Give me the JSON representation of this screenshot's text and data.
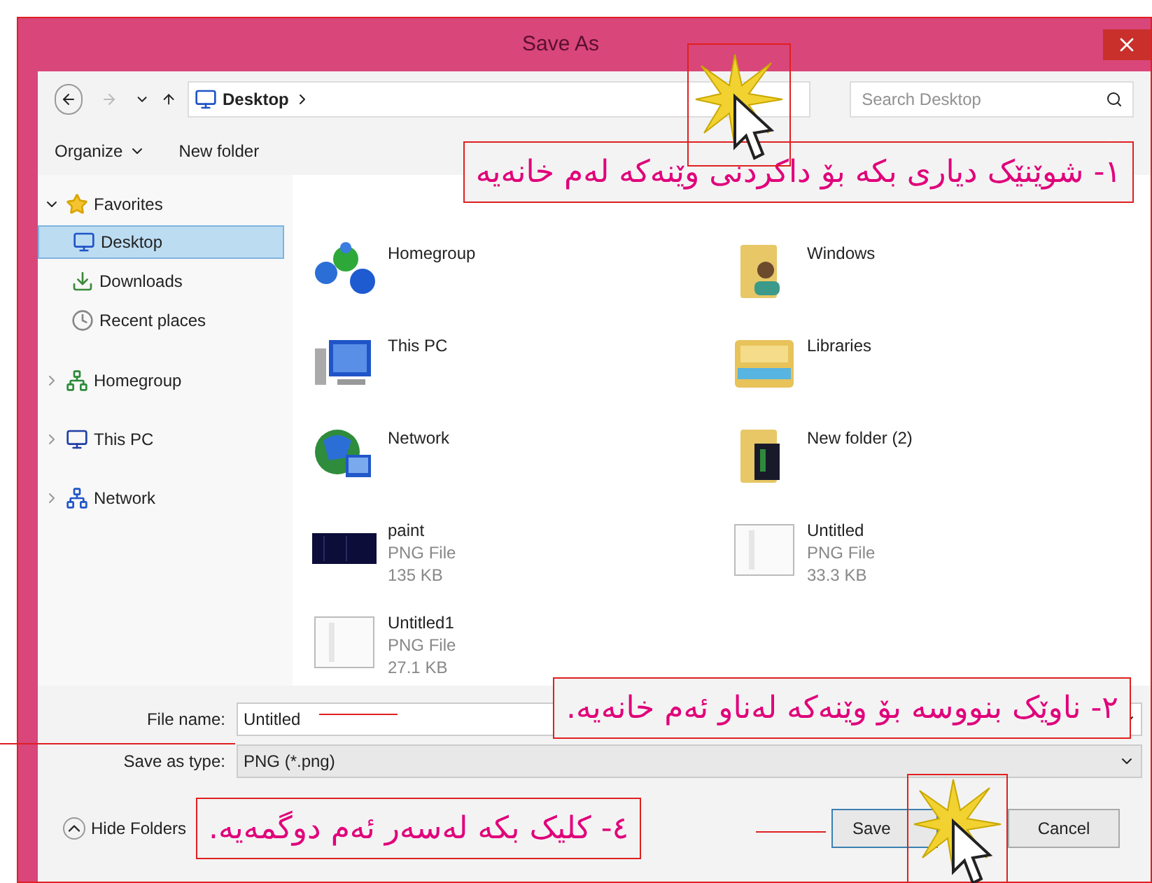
{
  "window": {
    "title": "Save As"
  },
  "address": {
    "location": "Desktop",
    "search_placeholder": "Search Desktop"
  },
  "toolbar": {
    "organize": "Organize",
    "new_folder": "New folder"
  },
  "sidebar": [
    {
      "label": "Favorites",
      "kind": "favorites",
      "expanded": true,
      "selected": false,
      "children": [
        {
          "label": "Desktop",
          "kind": "desktop",
          "selected": true
        },
        {
          "label": "Downloads",
          "kind": "downloads",
          "selected": false
        },
        {
          "label": "Recent places",
          "kind": "recent",
          "selected": false
        }
      ]
    },
    {
      "label": "Homegroup",
      "kind": "homegroup",
      "expanded": false,
      "selected": false
    },
    {
      "label": "This PC",
      "kind": "pc",
      "expanded": false,
      "selected": false
    },
    {
      "label": "Network",
      "kind": "network",
      "expanded": false,
      "selected": false
    }
  ],
  "files": [
    {
      "name": "Homegroup",
      "kind": "homegroup"
    },
    {
      "name": "Windows",
      "kind": "user-folder"
    },
    {
      "name": "This PC",
      "kind": "pc"
    },
    {
      "name": "Libraries",
      "kind": "library"
    },
    {
      "name": "Network",
      "kind": "network"
    },
    {
      "name": "New folder (2)",
      "kind": "folder"
    },
    {
      "name": "paint",
      "kind": "dark-image",
      "type": "PNG File",
      "size": "135 KB"
    },
    {
      "name": "Untitled",
      "kind": "light-image",
      "type": "PNG File",
      "size": "33.3 KB"
    },
    {
      "name": "Untitled1",
      "kind": "light-image",
      "type": "PNG File",
      "size": "27.1 KB"
    }
  ],
  "form": {
    "file_name_label": "File name:",
    "file_name": "Untitled",
    "save_type_label": "Save as type:",
    "save_type": "PNG (*.png)"
  },
  "footer": {
    "hide_folders": "Hide Folders",
    "save": "Save",
    "cancel": "Cancel"
  },
  "annotations": [
    {
      "kind": "top",
      "text": "١- شوێنێک دیاری بکە بۆ داکردنی وێنەکە لەم خانەیە"
    },
    {
      "kind": "name",
      "text": "٢- ناوێک بنووسە بۆ وێنەکە لەناو ئەم خانەیە."
    },
    {
      "kind": "save",
      "text": "٤- کلیک بکە لەسەر ئەم دوگمەیە."
    }
  ]
}
